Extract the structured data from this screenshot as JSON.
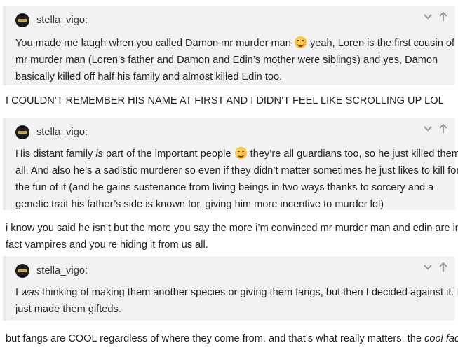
{
  "quotes": [
    {
      "username": "stella_vigo:",
      "lines": [
        [
          "You made me laugh when you called Damon mr murder man ",
          "emoji:rolling-on-floor-laughing",
          " yeah, Loren is the first cousin of"
        ],
        [
          "mr murder man (Loren’s father and Damon and Edin’s mother were siblings) and yes, Damon"
        ],
        [
          "basically killed off half his family and almost killed Edin too."
        ]
      ]
    },
    {
      "username": "stella_vigo:",
      "lines": [
        [
          "His distant family ",
          "em:is",
          " part of the important people ",
          "emoji:rolling-on-floor-laughing",
          " they’re all guardians too, so he just killed them"
        ],
        [
          "all. And also he’s a sadistic murderer so even if they didn’t matter sometimes he just likes to kill for"
        ],
        [
          "the fun of it (and he gains sustenance from living beings in two ways thanks to sorcery and a"
        ],
        [
          "genetic trait his father’s side is known for, giving him more incentive to murder lol)"
        ]
      ]
    },
    {
      "username": "stella_vigo:",
      "lines": [
        [
          "I ",
          "em:was",
          " thinking of making them another species or giving them fangs, but then I decided against it. I"
        ],
        [
          "just made them gifteds."
        ]
      ]
    }
  ],
  "replies": [
    {
      "lines": [
        [
          "I COULDN’T REMEMBER HIS NAME AT FIRST AND I DIDN’T FEEL LIKE SCROLLING UP LOL"
        ]
      ]
    },
    {
      "lines": [
        [
          "i know you said he isn’t but the more you say the more i’m convinced mr murder man and edin are in"
        ],
        [
          "fact vampires and you’re hiding it from us all."
        ]
      ]
    },
    {
      "lines": [
        [
          "but fangs are COOL regardless of where they come from. and that’s what really matters. the ",
          "em:cool factor"
        ]
      ]
    }
  ],
  "controls": {
    "expand_icon": "chevron-down-icon",
    "jump_icon": "arrow-up-icon"
  },
  "colors": {
    "quote_background": "#f2f2f2",
    "quote_border": "#e9e9e9",
    "text": "#222222",
    "icon": "#9a9a9a"
  }
}
